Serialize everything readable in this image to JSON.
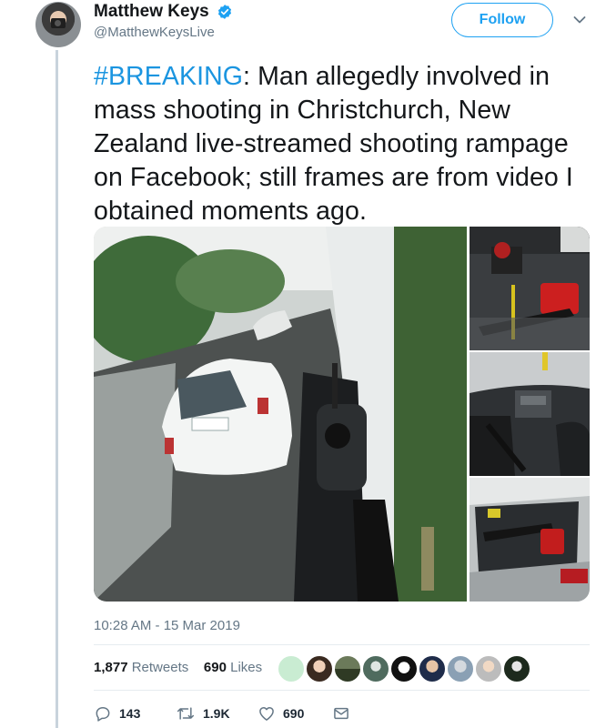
{
  "author": {
    "name": "Matthew Keys",
    "handle": "@MatthewKeysLive",
    "verified": true
  },
  "follow_label": "Follow",
  "tweet": {
    "hashtag": "#BREAKING",
    "body": ": Man allegedly involved in mass shooting in Christchurch, New Zealand live-streamed shooting rampage on Facebook; still frames are from video I obtained moments ago."
  },
  "timestamp": "10:28 AM - 15 Mar 2019",
  "stats": {
    "retweets_count": "1,877",
    "retweets_label": "Retweets",
    "likes_count": "690",
    "likes_label": "Likes"
  },
  "actions": {
    "reply_count": "143",
    "retweet_count": "1.9K",
    "like_count": "690"
  },
  "colors": {
    "accent": "#1da1f2",
    "hashtag": "#1b95e0",
    "muted": "#657786",
    "thread_line": "#c8d3dc"
  },
  "icons": [
    "verified-badge-icon",
    "chevron-down-icon",
    "reply-icon",
    "retweet-icon",
    "heart-icon",
    "direct-message-icon"
  ]
}
